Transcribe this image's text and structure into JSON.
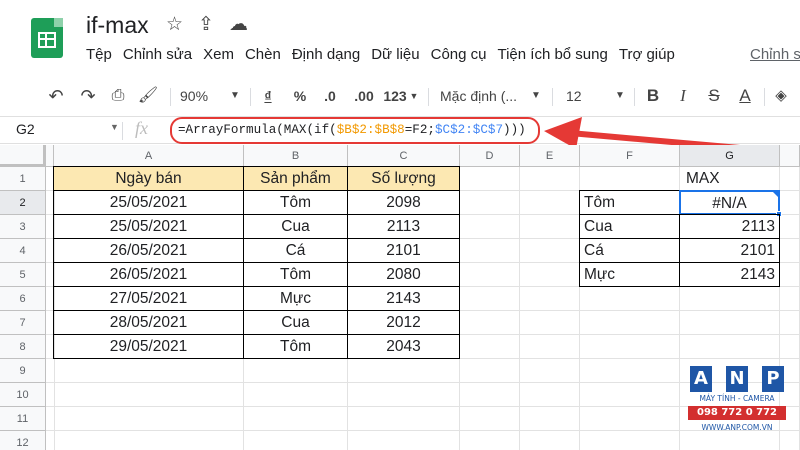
{
  "app": {
    "title": "if-max",
    "last_edit": "Chỉnh s"
  },
  "menu": [
    "Tệp",
    "Chỉnh sửa",
    "Xem",
    "Chèn",
    "Định dạng",
    "Dữ liệu",
    "Công cụ",
    "Tiện ích bổ sung",
    "Trợ giúp"
  ],
  "toolbar": {
    "zoom": "90%",
    "currency": "₫",
    "percent": "%",
    "dec_decrease": ".0",
    "dec_increase": ".00",
    "number_format": "123",
    "font": "Mặc định (...",
    "font_size": "12",
    "bold": "B",
    "italic": "I",
    "strike": "S",
    "text_color": "A"
  },
  "formula_bar": {
    "cell_ref": "G2",
    "fx": "fx",
    "parts": [
      "=ArrayFormula(MAX(if(",
      "$B$2:$B$8",
      "=F2;",
      "$C$2:$C$7",
      ")))"
    ]
  },
  "columns": [
    "A",
    "B",
    "C",
    "D",
    "E",
    "F",
    "G"
  ],
  "rows": [
    "1",
    "2",
    "3",
    "4",
    "5",
    "6",
    "7",
    "8",
    "9",
    "10",
    "11",
    "12"
  ],
  "table": {
    "headers": [
      "Ngày bán",
      "Sản phẩm",
      "Số lượng"
    ],
    "rows": [
      [
        "25/05/2021",
        "Tôm",
        "2098"
      ],
      [
        "25/05/2021",
        "Cua",
        "2113"
      ],
      [
        "26/05/2021",
        "Cá",
        "2101"
      ],
      [
        "26/05/2021",
        "Tôm",
        "2080"
      ],
      [
        "27/05/2021",
        "Mực",
        "2143"
      ],
      [
        "28/05/2021",
        "Cua",
        "2012"
      ],
      [
        "29/05/2021",
        "Tôm",
        "2043"
      ]
    ]
  },
  "summary": {
    "header": "MAX",
    "rows": [
      [
        "Tôm",
        "#N/A"
      ],
      [
        "Cua",
        "2113"
      ],
      [
        "Cá",
        "2101"
      ],
      [
        "Mực",
        "2143"
      ]
    ]
  },
  "watermark": {
    "letters": [
      "A",
      "N",
      "P"
    ],
    "line1": "MÁY TÍNH - CAMERA",
    "phone": "098 772 0 772",
    "site": "WWW.ANP.COM.VN"
  },
  "colors": {
    "header_fill": "#fce8b2",
    "selection": "#1a73e8",
    "annotation": "#e53935"
  }
}
